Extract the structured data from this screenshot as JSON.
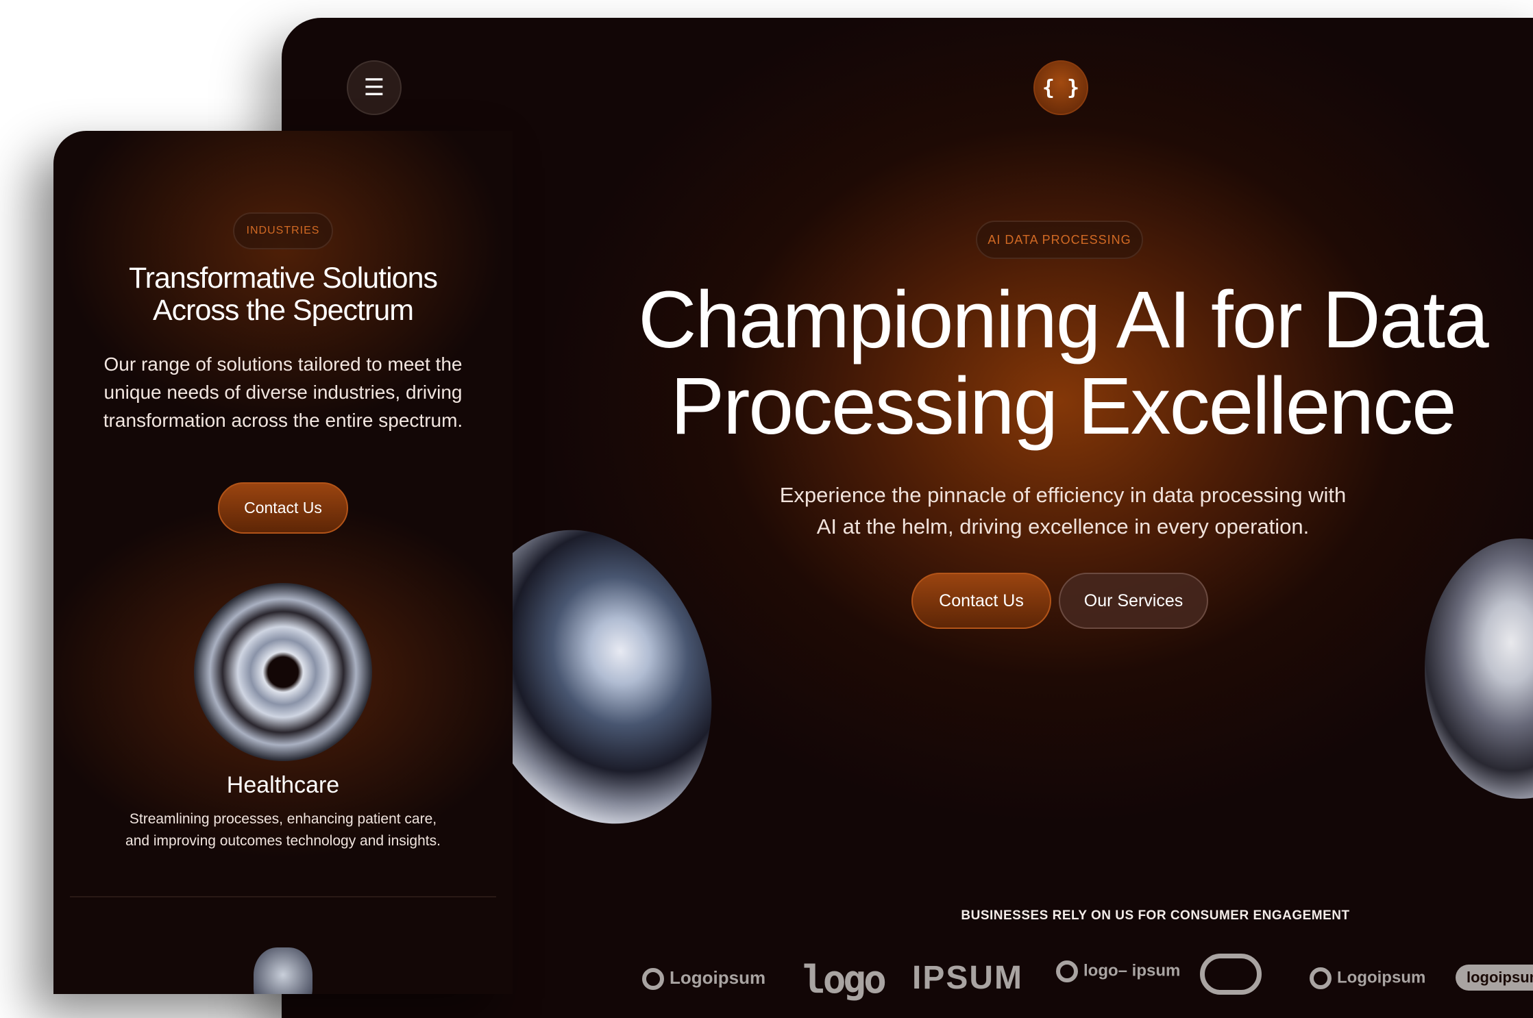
{
  "desktop": {
    "menu_icon": "☰",
    "logo_icon": "{ }",
    "tag": "AI DATA PROCESSING",
    "title_line1": "Championing AI for Data",
    "title_line2": "Processing Excellence",
    "subtitle_line1": "Experience the pinnacle of efficiency in data processing with",
    "subtitle_line2": "AI at the helm, driving excellence in every operation.",
    "contact_label": "Contact Us",
    "services_label": "Our Services",
    "rely_text": "BUSINESSES RELY ON US FOR CONSUMER ENGAGEMENT",
    "logos": [
      "Logoipsum",
      "logo",
      "IPSUM",
      "logo– ipsum",
      "Logoipsum",
      "logoipsum"
    ]
  },
  "mobile": {
    "tag": "INDUSTRIES",
    "title_line1": "Transformative Solutions",
    "title_line2": "Across the Spectrum",
    "description": "Our range of solutions tailored to meet the unique needs of diverse industries, driving transformation across the entire spectrum.",
    "contact_label": "Contact Us",
    "industry_title": "Healthcare",
    "industry_desc_line1": "Streamlining processes, enhancing patient care,",
    "industry_desc_line2": "and improving outcomes technology and insights."
  },
  "colors": {
    "accent": "#d26a24",
    "button": "#9a4410",
    "background": "#120606"
  }
}
